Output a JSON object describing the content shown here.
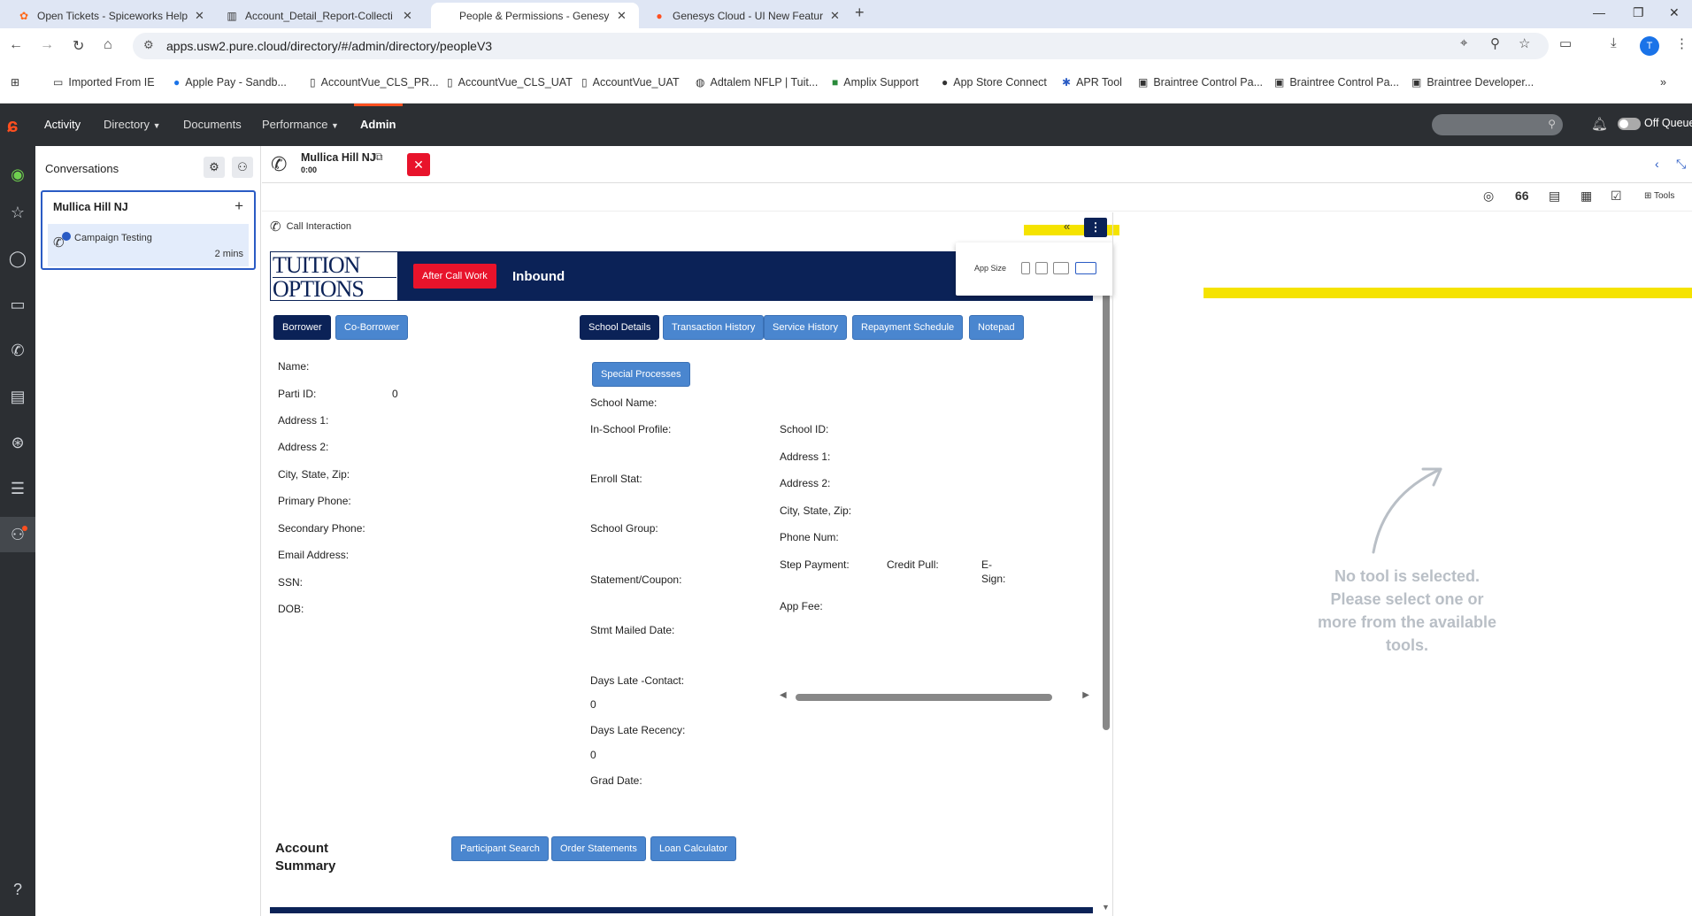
{
  "browser": {
    "tabs": [
      {
        "title": "Open Tickets - Spiceworks Help",
        "active": false
      },
      {
        "title": "Account_Detail_Report-Collecti",
        "active": false
      },
      {
        "title": "People & Permissions - Genesy",
        "active": true
      },
      {
        "title": "Genesys Cloud - UI New Featur",
        "active": false
      }
    ],
    "url": "apps.usw2.pure.cloud/directory/#/admin/directory/peopleV3",
    "profile_initial": "T",
    "bookmarks": [
      "Imported From IE",
      "Apple Pay - Sandb...",
      "AccountVue_CLS_PR...",
      "AccountVue_CLS_UAT",
      "AccountVue_UAT",
      "Adtalem NFLP | Tuit...",
      "Amplix Support",
      "App Store Connect",
      "APR Tool",
      "Braintree Control Pa...",
      "Braintree Control Pa...",
      "Braintree Developer..."
    ]
  },
  "appbar": {
    "nav": [
      "Activity",
      "Directory",
      "Documents",
      "Performance",
      "Admin"
    ],
    "queue_label": "Off Queue"
  },
  "conversations": {
    "title": "Conversations",
    "card_name": "Mullica Hill NJ",
    "item_label": "Campaign Testing",
    "item_time": "2 mins"
  },
  "interaction": {
    "name": "Mullica Hill NJ",
    "timer": "0:00",
    "tools_label": "Tools",
    "tool_count": "66",
    "call_label": "Call Interaction"
  },
  "app_size": {
    "label": "App Size"
  },
  "embedded": {
    "logo_line1": "TUITION",
    "logo_line2": "OPTIONS",
    "acw_label": "After Call Work",
    "direction": "Inbound",
    "buttons_left": [
      "Borrower",
      "Co-Borrower"
    ],
    "buttons_right": [
      "School Details",
      "Transaction History",
      "Service History",
      "Repayment Schedule",
      "Notepad"
    ],
    "special_processes": "Special Processes",
    "borrower_fields": {
      "name": "Name:",
      "parti_id": "Parti ID:",
      "parti_id_value": "0",
      "address1": "Address 1:",
      "address2": "Address 2:",
      "city": "City, State, Zip:",
      "primary_phone": "Primary Phone:",
      "secondary_phone": "Secondary Phone:",
      "email": "Email Address:",
      "ssn": "SSN:",
      "dob": "DOB:"
    },
    "school_fields": {
      "school_name": "School Name:",
      "in_school_profile": "In-School Profile:",
      "enroll_stat": "Enroll Stat:",
      "school_group": "School Group:",
      "statement_coupon": "Statement/Coupon:",
      "stmt_mailed_date": "Stmt Mailed Date:",
      "days_late_contact": "Days Late -Contact:",
      "days_late_contact_value": "0",
      "days_late_recency": "Days Late Recency:",
      "days_late_recency_value": "0",
      "grad_date": "Grad Date:"
    },
    "school_right_fields": {
      "school_id": "School ID:",
      "address1": "Address 1:",
      "address2": "Address 2:",
      "city": "City, State, Zip:",
      "phone": "Phone Num:",
      "step_payment": "Step Payment:",
      "credit_pull": "Credit Pull:",
      "esign_1": "E-",
      "esign_2": "Sign:",
      "app_fee": "App Fee:"
    },
    "account_summary_1": "Account",
    "account_summary_2": "Summary",
    "bottom_buttons": [
      "Participant Search",
      "Order Statements",
      "Loan Calculator"
    ]
  },
  "no_tool": {
    "line1": "No tool is selected.",
    "line2": "Please select one or",
    "line3": "more from the available",
    "line4": "tools."
  }
}
